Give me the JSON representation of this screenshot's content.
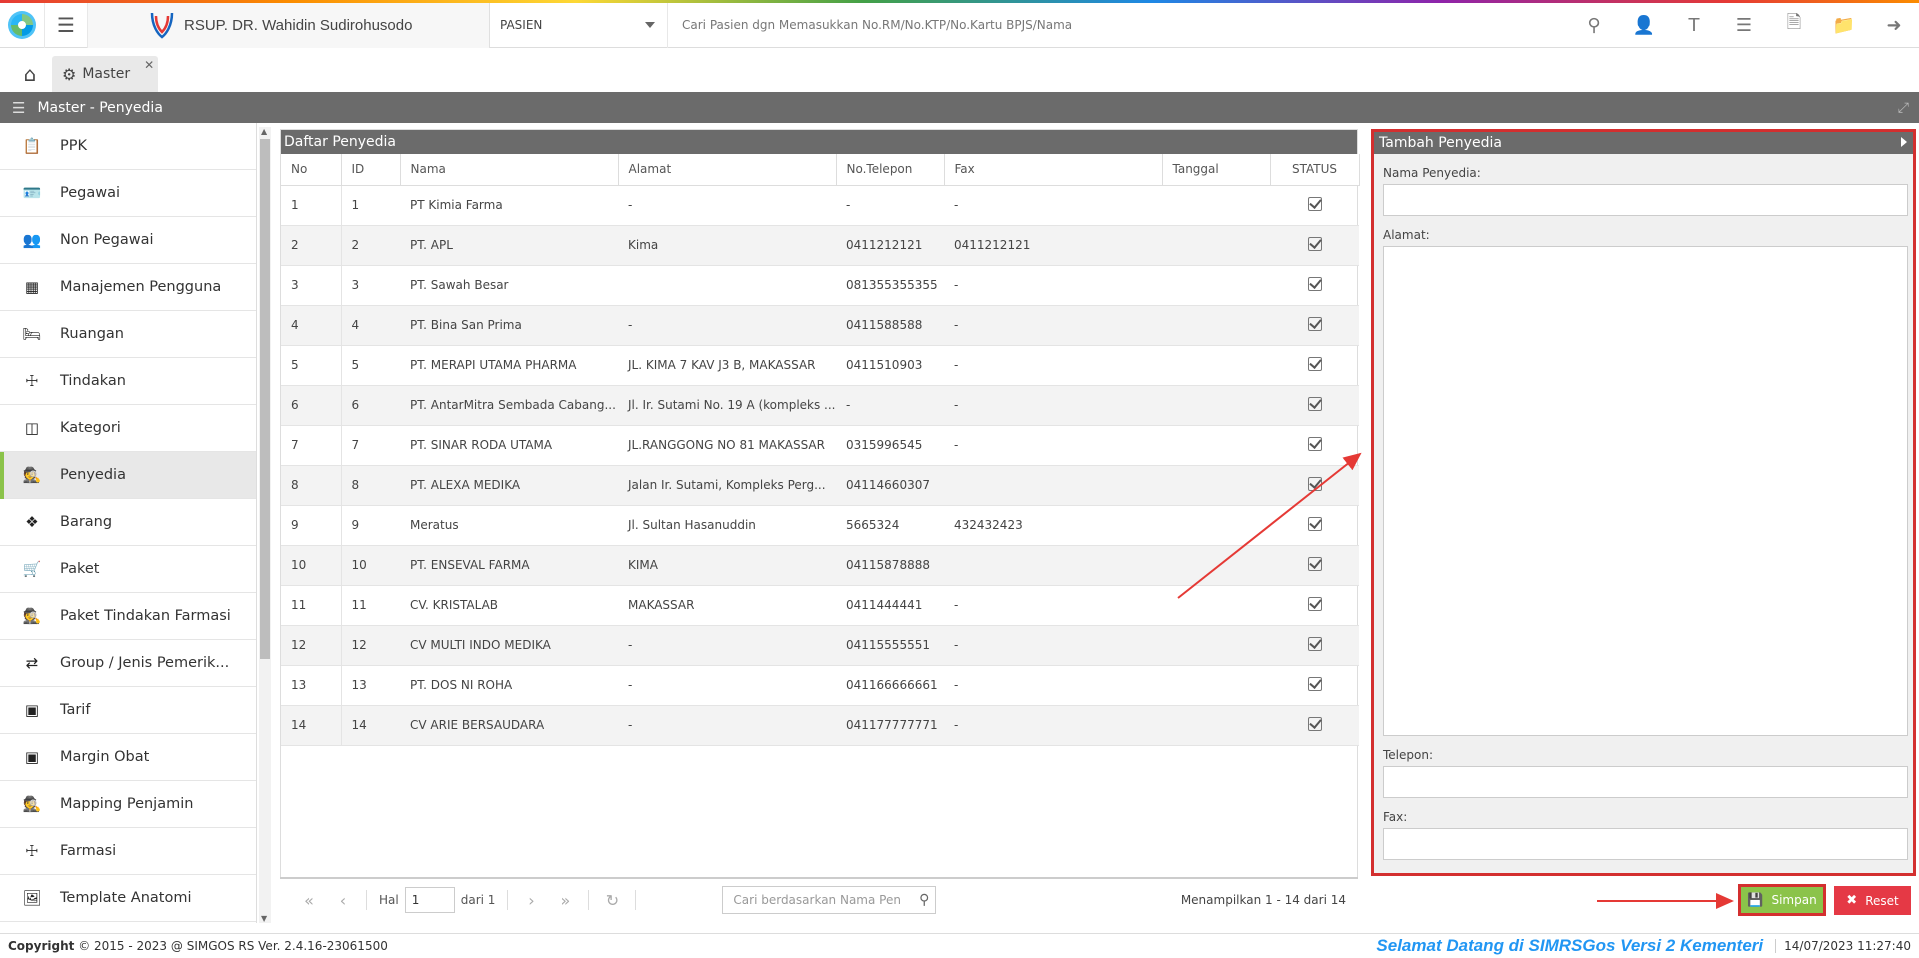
{
  "header": {
    "hospital_name": "RSUP. DR. Wahidin Sudirohusodo",
    "patient_select": "PASIEN",
    "search_placeholder": "Cari Pasien dgn Memasukkan No.RM/No.KTP/No.Kartu BPJS/Nama",
    "icons": [
      "search-icon",
      "add-user-icon",
      "text-icon",
      "list-icon",
      "pdf-icon",
      "folder-icon",
      "logout-icon"
    ]
  },
  "tabs": [
    {
      "label": "Master"
    }
  ],
  "section": {
    "title": "Master - Penyedia"
  },
  "sidebar": {
    "items": [
      {
        "label": "PPK",
        "icon": "clipboard-icon"
      },
      {
        "label": "Pegawai",
        "icon": "id-card-icon"
      },
      {
        "label": "Non Pegawai",
        "icon": "users-icon"
      },
      {
        "label": "Manajemen Pengguna",
        "icon": "table-icon"
      },
      {
        "label": "Ruangan",
        "icon": "bed-icon"
      },
      {
        "label": "Tindakan",
        "icon": "medkit-icon"
      },
      {
        "label": "Kategori",
        "icon": "cube-icon"
      },
      {
        "label": "Penyedia",
        "icon": "user-secret-icon"
      },
      {
        "label": "Barang",
        "icon": "cubes-icon"
      },
      {
        "label": "Paket",
        "icon": "cart-icon"
      },
      {
        "label": "Paket Tindakan Farmasi",
        "icon": "user-secret-icon"
      },
      {
        "label": "Group / Jenis Pemerik...",
        "icon": "exchange-icon"
      },
      {
        "label": "Tarif",
        "icon": "money-icon"
      },
      {
        "label": "Margin Obat",
        "icon": "money-icon"
      },
      {
        "label": "Mapping Penjamin",
        "icon": "user-secret-icon"
      },
      {
        "label": "Farmasi",
        "icon": "medkit-icon"
      },
      {
        "label": "Template Anatomi",
        "icon": "image-icon"
      }
    ],
    "active_index": 7
  },
  "grid": {
    "title": "Daftar Penyedia",
    "columns": [
      "No",
      "ID",
      "Nama",
      "Alamat",
      "No.Telepon",
      "Fax",
      "Tanggal",
      "STATUS"
    ],
    "rows": [
      {
        "no": "1",
        "id": "1",
        "nama": "PT Kimia Farma",
        "alamat": "-",
        "telp": "-",
        "fax": "-",
        "tanggal": ""
      },
      {
        "no": "2",
        "id": "2",
        "nama": "PT. APL",
        "alamat": "Kima",
        "telp": "0411212121",
        "fax": "0411212121",
        "tanggal": ""
      },
      {
        "no": "3",
        "id": "3",
        "nama": "PT. Sawah Besar",
        "alamat": "",
        "telp": "081355355355",
        "fax": "-",
        "tanggal": ""
      },
      {
        "no": "4",
        "id": "4",
        "nama": "PT. Bina San Prima",
        "alamat": "-",
        "telp": "0411588588",
        "fax": "-",
        "tanggal": ""
      },
      {
        "no": "5",
        "id": "5",
        "nama": "PT. MERAPI UTAMA PHARMA",
        "alamat": "JL. KIMA 7 KAV J3 B, MAKASSAR",
        "telp": "0411510903",
        "fax": "-",
        "tanggal": ""
      },
      {
        "no": "6",
        "id": "6",
        "nama": "PT. AntarMitra Sembada Cabang...",
        "alamat": "Jl. Ir. Sutami No. 19 A (kompleks ...",
        "telp": "-",
        "fax": "-",
        "tanggal": ""
      },
      {
        "no": "7",
        "id": "7",
        "nama": "PT. SINAR RODA UTAMA",
        "alamat": "JL.RANGGONG NO 81 MAKASSAR",
        "telp": "0315996545",
        "fax": "-",
        "tanggal": ""
      },
      {
        "no": "8",
        "id": "8",
        "nama": "PT. ALEXA MEDIKA",
        "alamat": "Jalan Ir. Sutami, Kompleks Perg...",
        "telp": "04114660307",
        "fax": "",
        "tanggal": ""
      },
      {
        "no": "9",
        "id": "9",
        "nama": "Meratus",
        "alamat": "Jl. Sultan Hasanuddin",
        "telp": "5665324",
        "fax": "432432423",
        "tanggal": ""
      },
      {
        "no": "10",
        "id": "10",
        "nama": "PT. ENSEVAL FARMA",
        "alamat": "KIMA",
        "telp": "04115878888",
        "fax": "",
        "tanggal": ""
      },
      {
        "no": "11",
        "id": "11",
        "nama": "CV. KRISTALAB",
        "alamat": "MAKASSAR",
        "telp": "0411444441",
        "fax": "-",
        "tanggal": ""
      },
      {
        "no": "12",
        "id": "12",
        "nama": "CV MULTI INDO MEDIKA",
        "alamat": "-",
        "telp": "04115555551",
        "fax": "-",
        "tanggal": ""
      },
      {
        "no": "13",
        "id": "13",
        "nama": "PT. DOS NI ROHA",
        "alamat": "-",
        "telp": "041166666661",
        "fax": "-",
        "tanggal": ""
      },
      {
        "no": "14",
        "id": "14",
        "nama": "CV ARIE BERSAUDARA",
        "alamat": "-",
        "telp": "041177777771",
        "fax": "-",
        "tanggal": ""
      }
    ]
  },
  "pager": {
    "hal_label": "Hal",
    "page_value": "1",
    "of_label": "dari 1",
    "search_placeholder": "Cari berdasarkan Nama Pen",
    "info": "Menampilkan 1 - 14 dari 14"
  },
  "form": {
    "title": "Tambah Penyedia",
    "nama_label": "Nama Penyedia:",
    "alamat_label": "Alamat:",
    "telepon_label": "Telepon:",
    "fax_label": "Fax:",
    "save_label": "Simpan",
    "reset_label": "Reset"
  },
  "footer": {
    "copyright": "Copyright",
    "copyright_text": "2015 - 2023 @ SIMGOS RS Ver. 2.4.16-23061500",
    "welcome": "Selamat Datang di SIMRSGos Versi 2 Kementeri",
    "datetime": "14/07/2023 11:27:40"
  },
  "colors": {
    "accent_green": "#8bc34a",
    "reset_red": "#e53945",
    "highlight_red": "#d32f2f",
    "welcome_blue": "#2196f3"
  }
}
